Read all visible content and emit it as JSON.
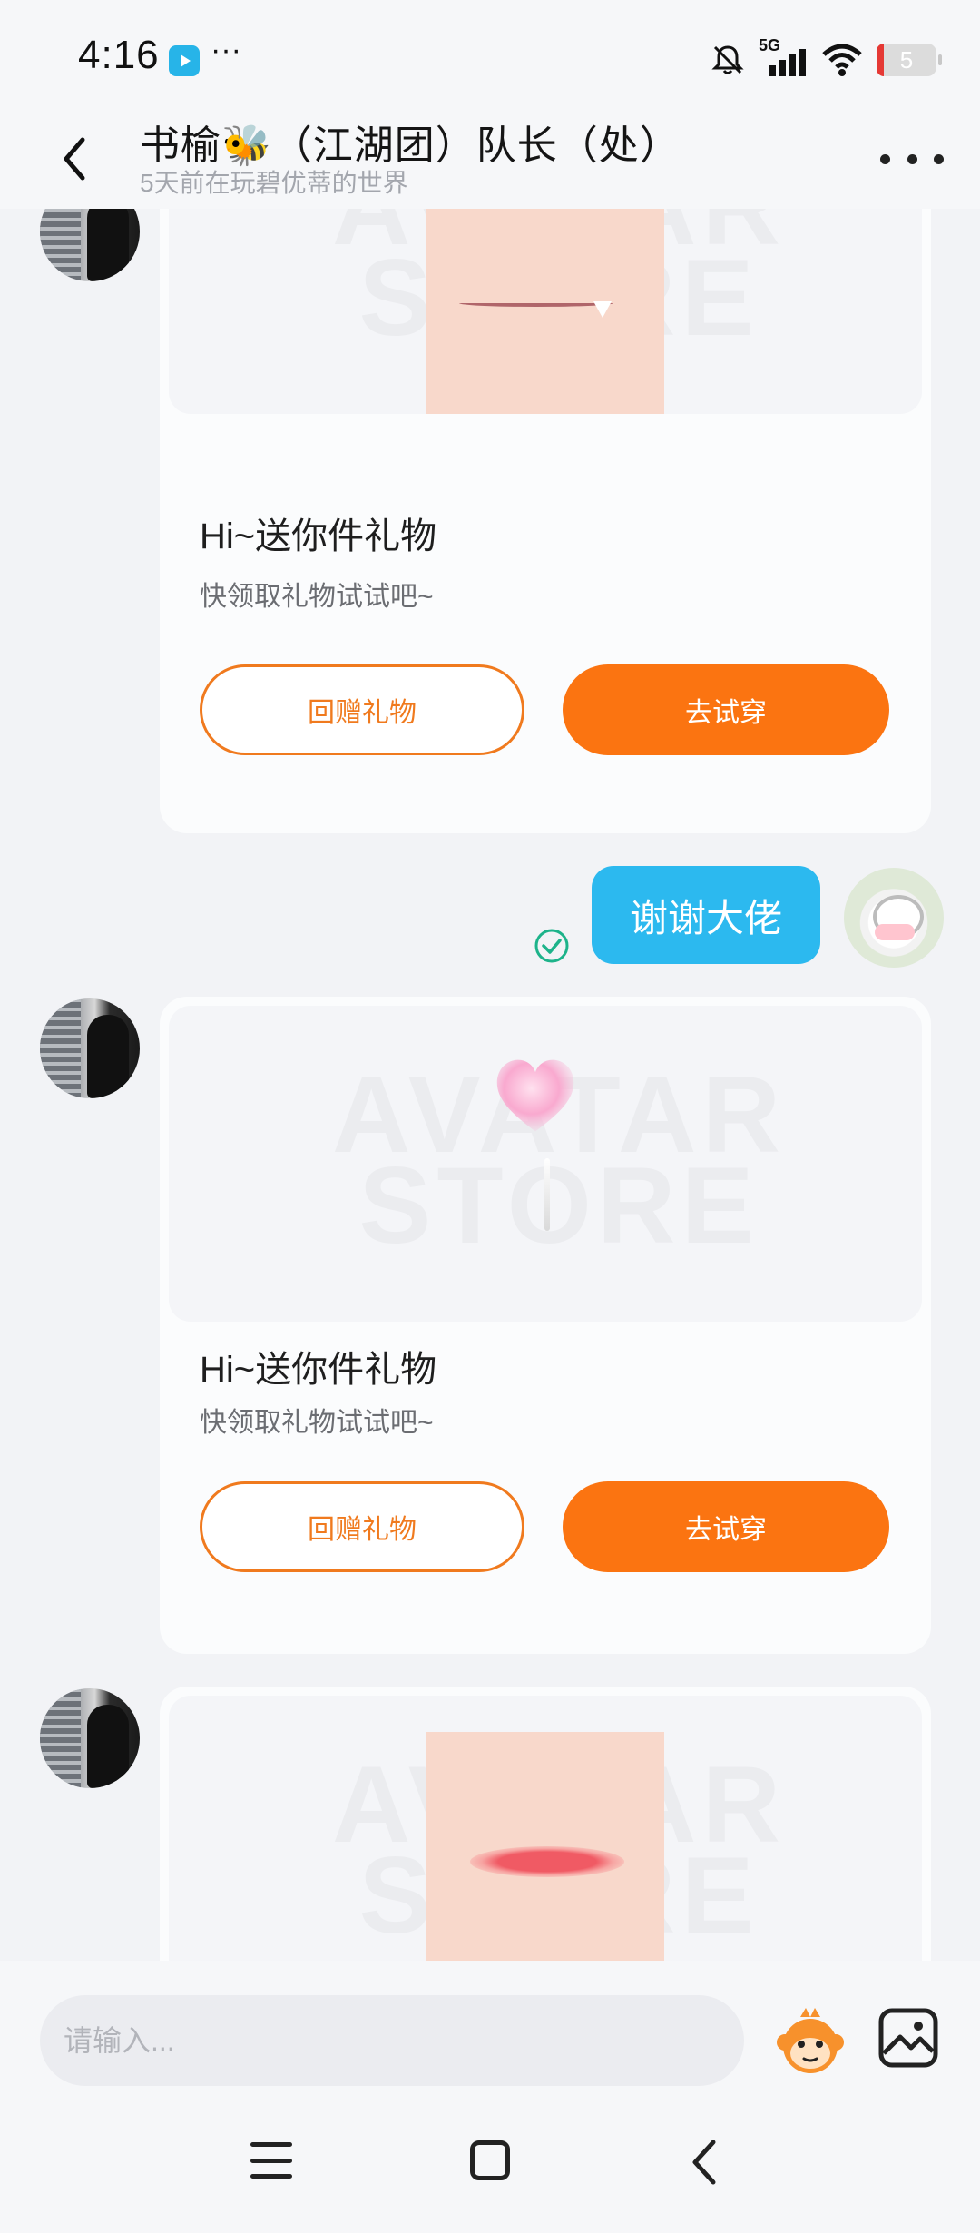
{
  "status_bar": {
    "time": "4:16",
    "more": "···",
    "network": "5G",
    "battery": "5"
  },
  "header": {
    "title": "书榆🐝（江湖团）队长（处）",
    "subtitle": "5天前在玩碧优蒂的世界"
  },
  "gift_cards": [
    {
      "title": "Hi~送你件礼物",
      "description": "快领取礼物试试吧~",
      "return_label": "回赠礼物",
      "try_label": "去试穿",
      "watermark": "AVATAR STORE"
    },
    {
      "title": "Hi~送你件礼物",
      "description": "快领取礼物试试吧~",
      "return_label": "回赠礼物",
      "try_label": "去试穿",
      "watermark": "AVATAR STORE"
    },
    {
      "watermark": "AVATAR STORE"
    }
  ],
  "my_message": {
    "text": "谢谢大佬"
  },
  "input": {
    "placeholder": "请输入..."
  },
  "colors": {
    "accent_orange": "#fb7411",
    "bubble_blue": "#2cb9ef",
    "read_green": "#1db38a"
  }
}
